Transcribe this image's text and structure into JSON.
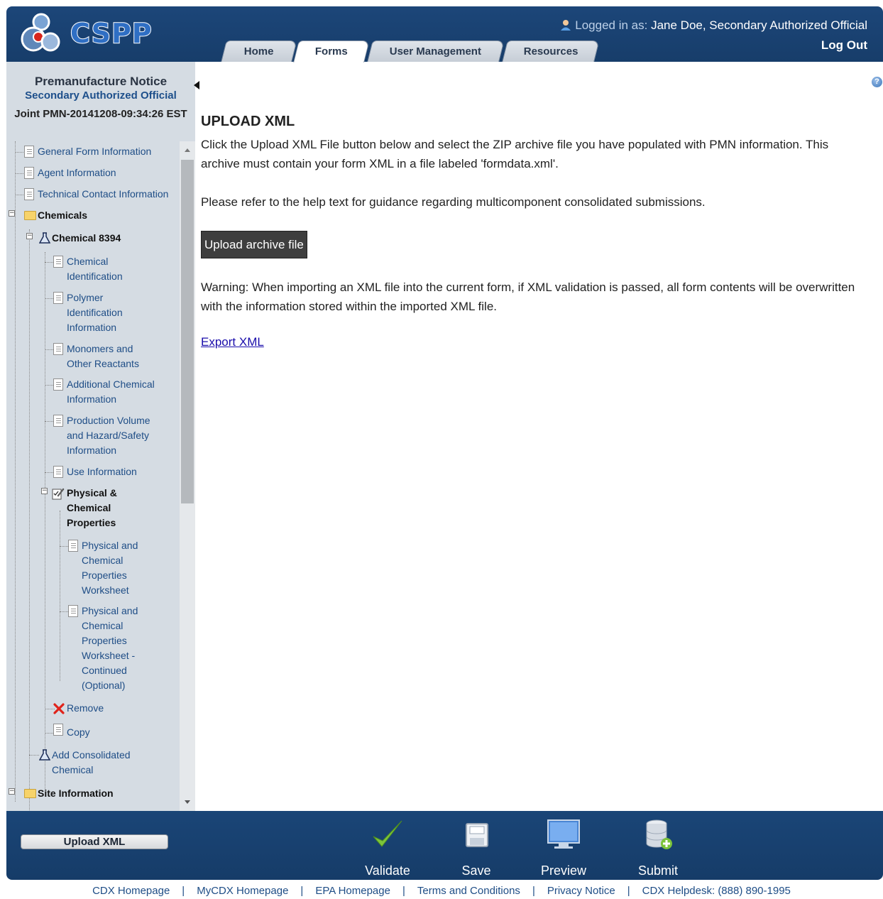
{
  "header": {
    "logo_text": "CSPP",
    "logged_in_prefix": "Logged in as:",
    "user_name": "Jane Doe, Secondary Authorized Official",
    "logout_label": "Log Out",
    "tabs": [
      {
        "label": "Home",
        "active": false
      },
      {
        "label": "Forms",
        "active": true
      },
      {
        "label": "User Management",
        "active": false
      },
      {
        "label": "Resources",
        "active": false
      }
    ]
  },
  "sidebar": {
    "title": "Premanufacture Notice",
    "subtitle": "Secondary Authorized Official",
    "form_id": "Joint PMN-20141208-09:34:26 EST",
    "tree": {
      "general_form_information": "General Form Information",
      "agent_information": "Agent Information",
      "technical_contact_information": "Technical Contact Information",
      "chemicals": "Chemicals",
      "chemical_8394": "Chemical 8394",
      "chemical_identification": [
        "Chemical",
        "Identification"
      ],
      "polymer_identification": [
        "Polymer",
        "Identification",
        "Information"
      ],
      "monomers": [
        "Monomers and",
        "Other Reactants"
      ],
      "additional_chemical": [
        "Additional Chemical",
        "Information"
      ],
      "production_volume": [
        "Production Volume",
        "and Hazard/Safety",
        "Information"
      ],
      "use_information": "Use Information",
      "physical_chemical_properties": [
        "Physical &",
        "Chemical",
        "Properties"
      ],
      "worksheet": [
        "Physical and",
        "Chemical",
        "Properties",
        "Worksheet"
      ],
      "worksheet_continued": [
        "Physical and",
        "Chemical",
        "Properties",
        "Worksheet -",
        "Continued",
        "(Optional)"
      ],
      "remove": "Remove",
      "copy": "Copy",
      "add_consolidated": [
        "Add Consolidated",
        "Chemical"
      ],
      "site_information": "Site Information"
    }
  },
  "main": {
    "heading": "UPLOAD XML",
    "intro": "Click the Upload XML File button below and select the ZIP archive file you have populated with PMN information. This archive must contain your form XML in a file labeled 'formdata.xml'.",
    "help_note": "Please refer to the help text for guidance regarding multicomponent consolidated submissions.",
    "upload_button": "Upload archive file",
    "warning": "Warning: When importing an XML file into the current form, if XML validation is passed, all form contents will be overwritten with the information stored within the imported XML file.",
    "export_link": "Export XML"
  },
  "footer": {
    "upload_xml_button": "Upload XML",
    "actions": [
      {
        "label": "Validate",
        "icon": "checkmark-icon"
      },
      {
        "label": "Save",
        "icon": "save-icon"
      },
      {
        "label": "Preview",
        "icon": "monitor-icon"
      },
      {
        "label": "Submit",
        "icon": "database-add-icon"
      }
    ],
    "links": [
      "CDX Homepage",
      "MyCDX Homepage",
      "EPA Homepage",
      "Terms and Conditions",
      "Privacy Notice",
      "CDX Helpdesk: (888) 890-1995"
    ],
    "link_separator": "|"
  },
  "colors": {
    "header_bg": "#1c4679",
    "sidebar_bg": "#d5dce3",
    "link": "#1e4d86",
    "button_dark": "#3e3e3e"
  }
}
